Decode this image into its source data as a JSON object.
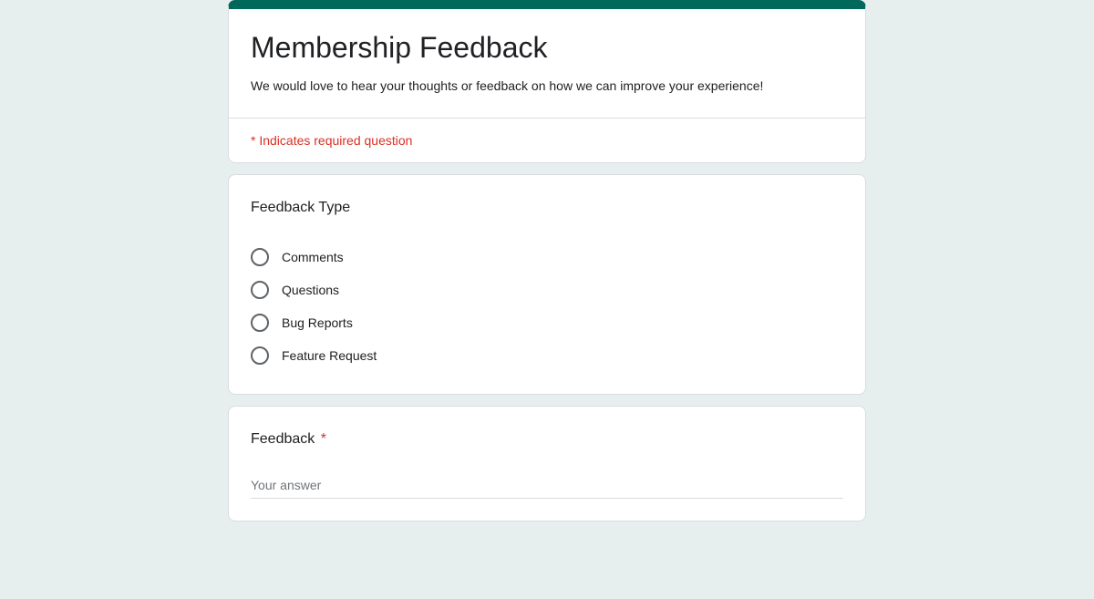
{
  "header": {
    "title": "Membership Feedback",
    "description": "We would love to hear your thoughts or feedback on how we can improve your experience!",
    "required_notice": "* Indicates required question"
  },
  "question1": {
    "title": "Feedback Type",
    "options": [
      "Comments",
      "Questions",
      "Bug Reports",
      "Feature Request"
    ]
  },
  "question2": {
    "title": "Feedback",
    "required_mark": "*",
    "placeholder": "Your answer"
  }
}
